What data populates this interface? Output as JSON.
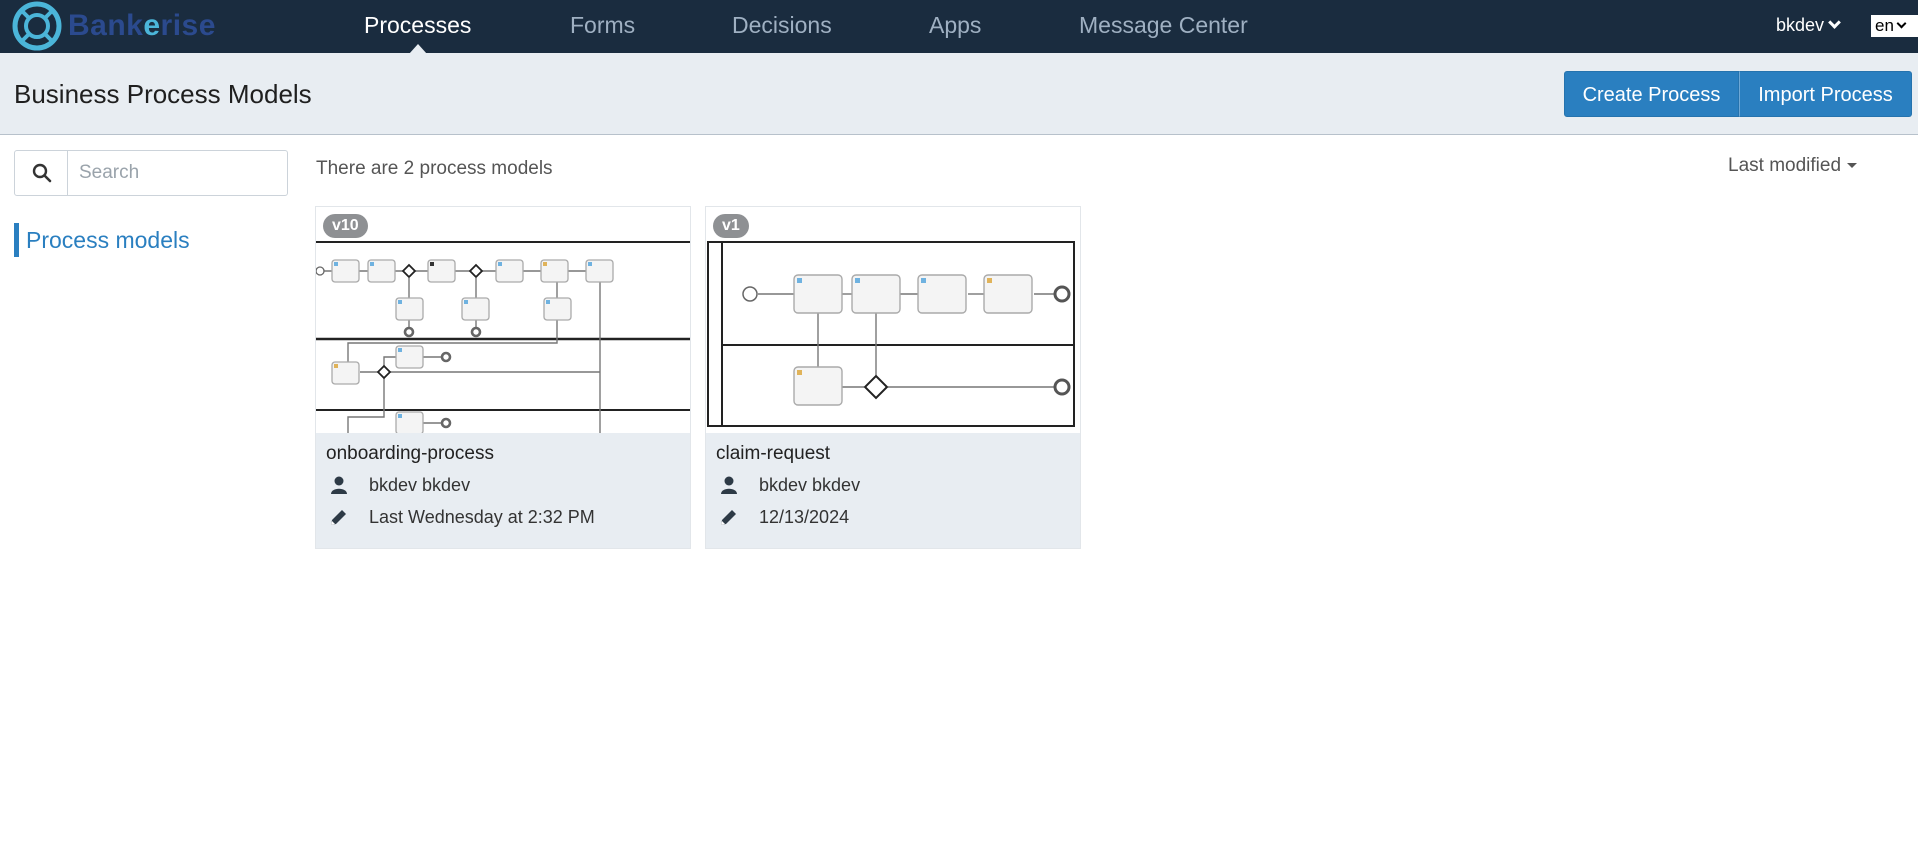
{
  "brand": {
    "name_part1": "Bank",
    "name_highlight": "e",
    "name_part2": "rise"
  },
  "nav": {
    "items": [
      {
        "label": "Processes",
        "active": true
      },
      {
        "label": "Forms",
        "active": false
      },
      {
        "label": "Decisions",
        "active": false
      },
      {
        "label": "Apps",
        "active": false
      },
      {
        "label": "Message Center",
        "active": false
      }
    ],
    "user": "bkdev",
    "language": "en"
  },
  "header": {
    "title": "Business Process Models",
    "create_label": "Create Process",
    "import_label": "Import Process"
  },
  "sidebar": {
    "search_placeholder": "Search",
    "items": [
      {
        "label": "Process models",
        "active": true
      }
    ]
  },
  "main": {
    "count_text": "There are 2 process models",
    "sort_label": "Last modified",
    "cards": [
      {
        "version": "v10",
        "name": "onboarding-process",
        "author": "bkdev bkdev",
        "modified": "Last Wednesday at 2:32 PM"
      },
      {
        "version": "v1",
        "name": "claim-request",
        "author": "bkdev bkdev",
        "modified": "12/13/2024"
      }
    ]
  },
  "colors": {
    "navbar_bg": "#1a2c3f",
    "accent": "#2a7fc0",
    "subheader_bg": "#e8edf2",
    "badge_bg": "#8e9093"
  },
  "icons": {
    "search": "search-icon",
    "author": "user-icon",
    "modified": "pencil-icon",
    "user_menu": "chevron-down-icon",
    "sort": "caret-down-icon"
  }
}
